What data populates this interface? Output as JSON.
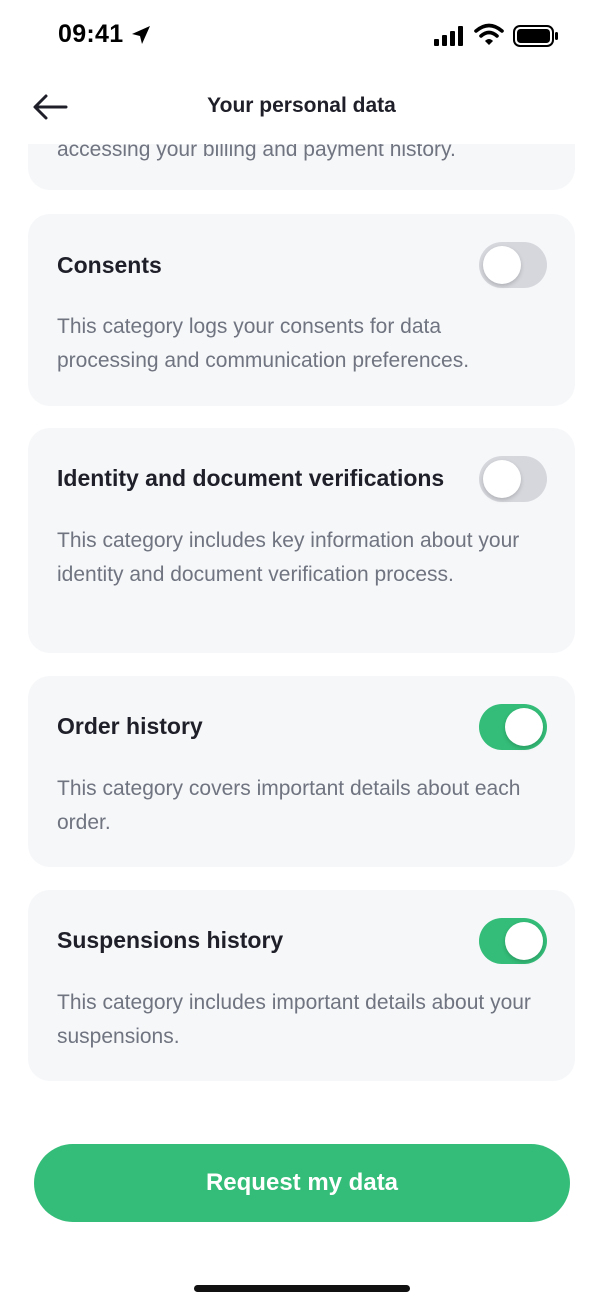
{
  "status_bar": {
    "time": "09:41",
    "icons": [
      "location-arrow-icon",
      "signal-icon",
      "wifi-icon",
      "battery-icon"
    ]
  },
  "nav": {
    "back_icon": "arrow-left-icon",
    "title": "Your personal data"
  },
  "partial_card": {
    "text": "accessing your billing and payment history."
  },
  "categories": [
    {
      "title": "Consents",
      "description": "This category logs your consents for data processing and communication preferences.",
      "enabled": false
    },
    {
      "title": "Identity and document verifications",
      "description": "This category includes key information about your identity and document verification process.",
      "enabled": false
    },
    {
      "title": "Order history",
      "description": "This category covers important details about each order.",
      "enabled": true
    },
    {
      "title": "Suspensions history",
      "description": "This category includes important details about your suspensions.",
      "enabled": true
    }
  ],
  "actions": {
    "request_label": "Request my data"
  },
  "colors": {
    "accent": "#34bd78",
    "card_bg": "#f6f7f9",
    "toggle_off": "#d5d7dd",
    "text_primary": "#1f1f29",
    "text_secondary": "#6f7480"
  }
}
